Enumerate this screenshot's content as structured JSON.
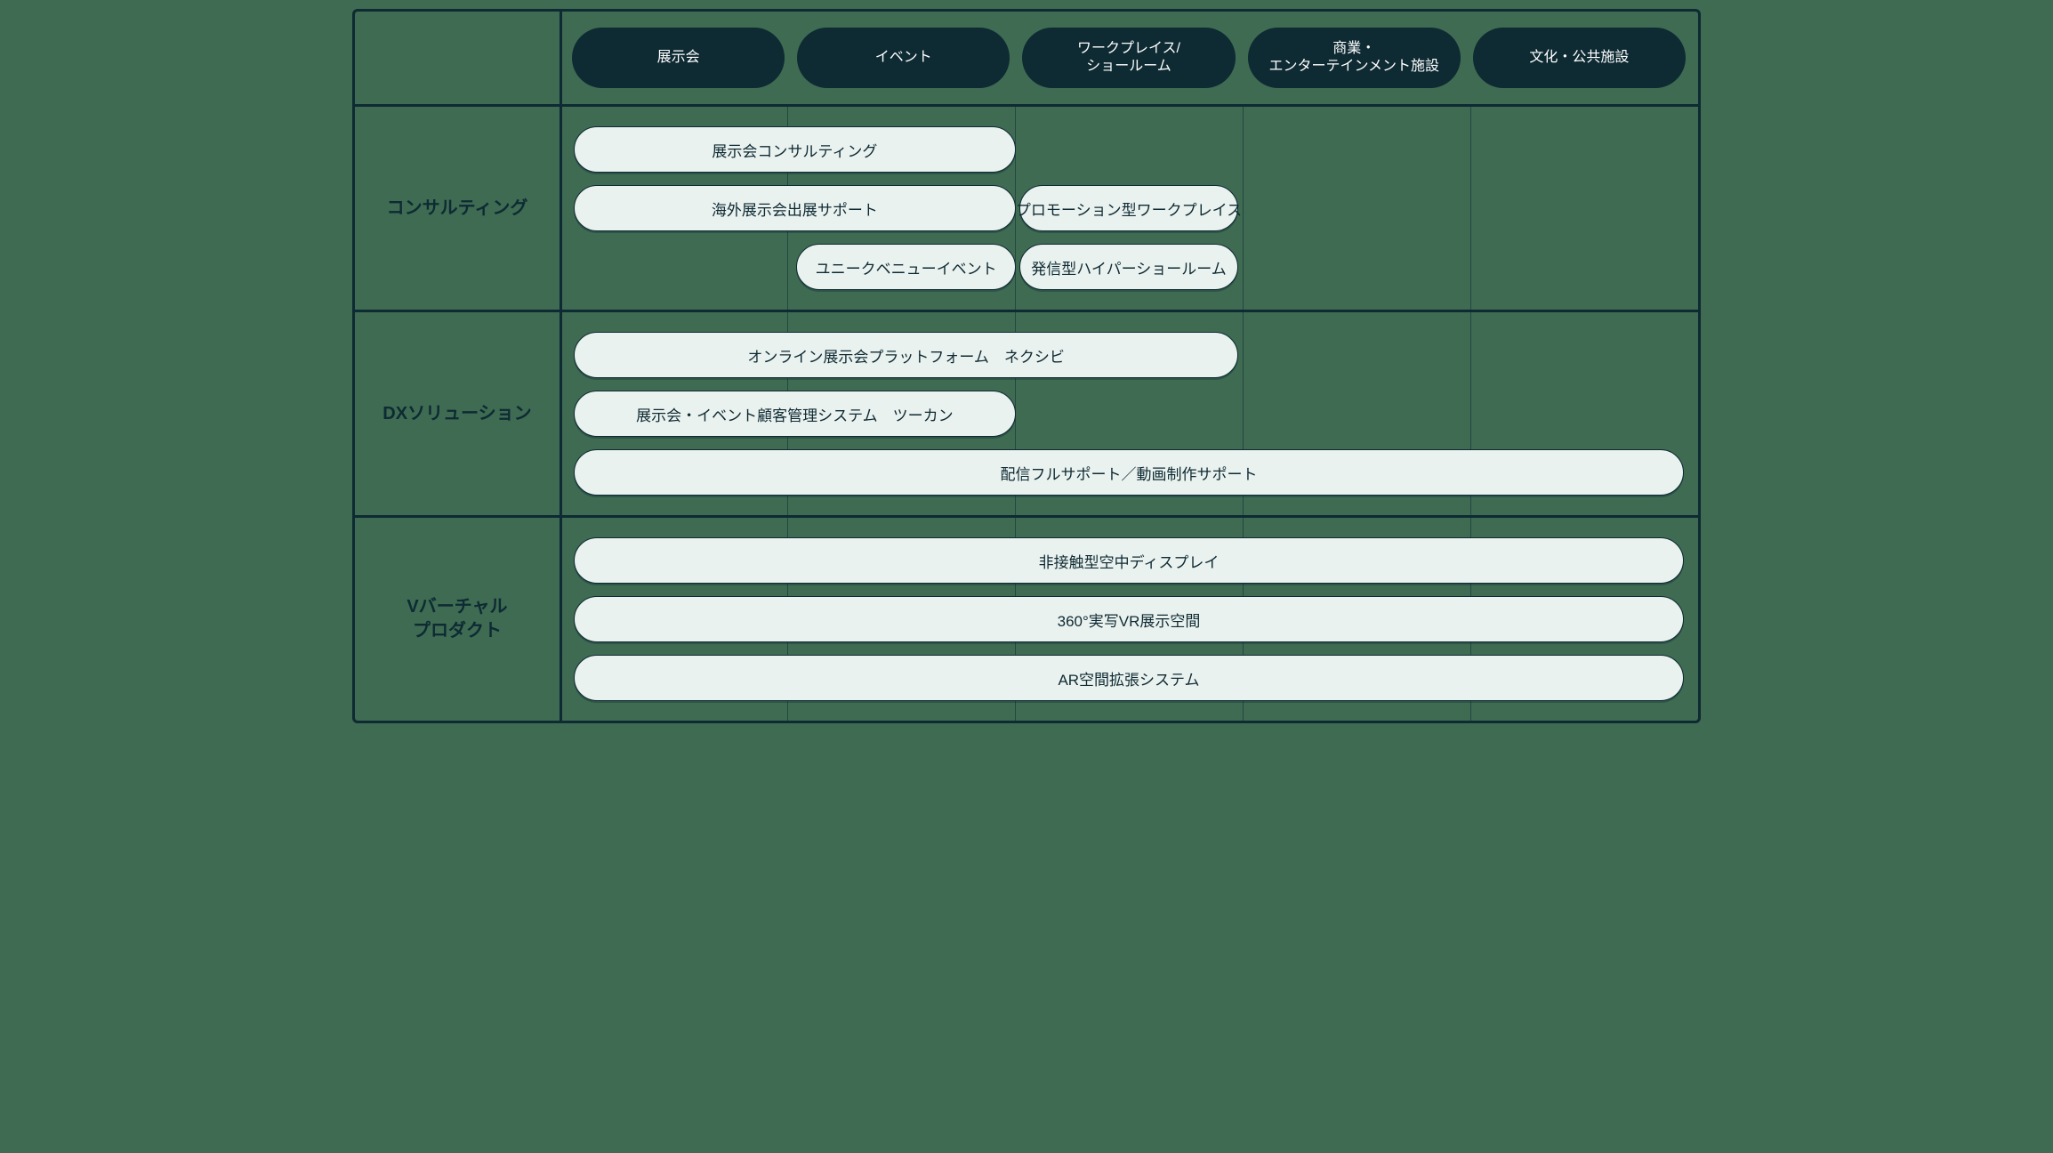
{
  "columns": [
    "展示会",
    "イベント",
    "ワークプレイス/\nショールーム",
    "商業・\nエンターテインメント施設",
    "文化・公共施設"
  ],
  "rows": [
    {
      "label": "コンサルティング",
      "items": [
        {
          "text": "展示会コンサルティング",
          "col_start": 0,
          "col_span": 2,
          "line": 0
        },
        {
          "text": "海外展示会出展サポート",
          "col_start": 0,
          "col_span": 2,
          "line": 1
        },
        {
          "text": "プロモーション型ワークプレイス",
          "col_start": 2,
          "col_span": 1,
          "line": 1
        },
        {
          "text": "ユニークベニューイベント",
          "col_start": 1,
          "col_span": 1,
          "line": 2
        },
        {
          "text": "発信型ハイパーショールーム",
          "col_start": 2,
          "col_span": 1,
          "line": 2
        }
      ]
    },
    {
      "label": "DXソリューション",
      "items": [
        {
          "text": "オンライン展示会プラットフォーム　ネクシビ",
          "col_start": 0,
          "col_span": 3,
          "line": 0
        },
        {
          "text": "展示会・イベント顧客管理システム　ツーカン",
          "col_start": 0,
          "col_span": 2,
          "line": 1
        },
        {
          "text": "配信フルサポート／動画制作サポート",
          "col_start": 0,
          "col_span": 5,
          "line": 2
        }
      ]
    },
    {
      "label": "Vバーチャル\nプロダクト",
      "items": [
        {
          "text": "非接触型空中ディスプレイ",
          "col_start": 0,
          "col_span": 5,
          "line": 0
        },
        {
          "text": "360°実写VR展示空間",
          "col_start": 0,
          "col_span": 5,
          "line": 1
        },
        {
          "text": "AR空間拡張システム",
          "col_start": 0,
          "col_span": 5,
          "line": 2
        }
      ]
    }
  ]
}
